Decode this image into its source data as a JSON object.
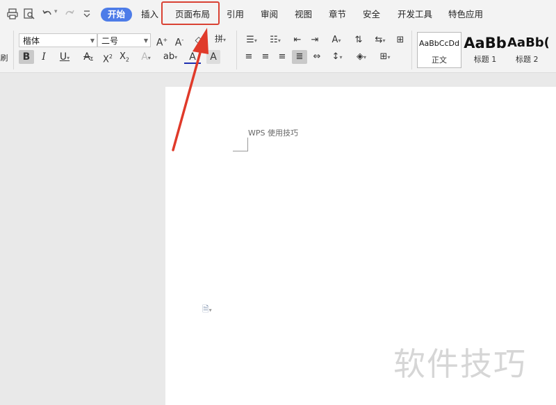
{
  "quick_access": [
    "print-icon",
    "print-preview-icon",
    "undo-icon",
    "redo-icon",
    "customize-icon"
  ],
  "tabs": [
    {
      "label": "开始",
      "active": true
    },
    {
      "label": "插入"
    },
    {
      "label": "页面布局",
      "highlighted": true
    },
    {
      "label": "引用"
    },
    {
      "label": "审阅"
    },
    {
      "label": "视图"
    },
    {
      "label": "章节"
    },
    {
      "label": "安全"
    },
    {
      "label": "开发工具"
    },
    {
      "label": "特色应用"
    }
  ],
  "ribbon": {
    "font_name": "楷体",
    "font_size": "二号",
    "left_edge_label": "刷",
    "styles": [
      {
        "preview": "AaBbCcDd",
        "label": "正文"
      },
      {
        "preview": "AaBb",
        "label": "标题 1"
      },
      {
        "preview": "AaBb(",
        "label": "标题 2"
      }
    ]
  },
  "document": {
    "text": "WPS 使用技巧"
  },
  "watermark": "软件技巧",
  "colors": {
    "active_tab": "#4d7ce8",
    "highlight_box": "#d94133",
    "arrow": "#e03a2a"
  }
}
